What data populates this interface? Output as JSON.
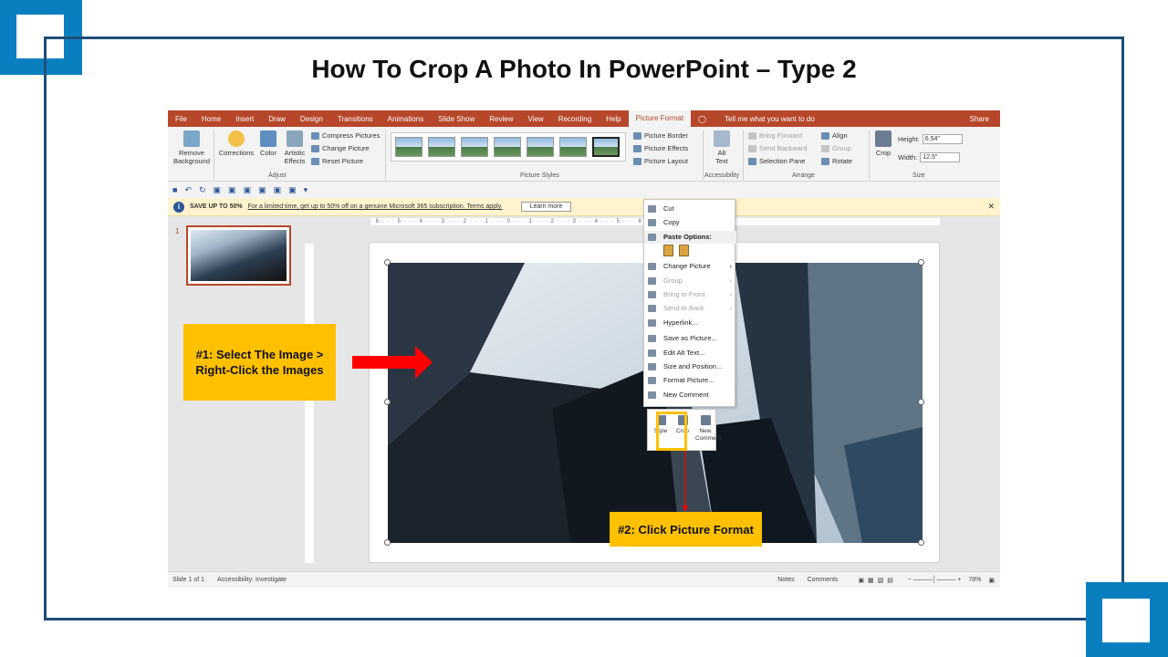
{
  "title": "How To Crop A Photo In PowerPoint – Type 2",
  "menubar": {
    "tabs": [
      "File",
      "Home",
      "Insert",
      "Draw",
      "Design",
      "Transitions",
      "Animations",
      "Slide Show",
      "Review",
      "View",
      "Recording",
      "Help",
      "Picture Format"
    ],
    "tell": "Tell me what you want to do",
    "share": "Share"
  },
  "ribbon": {
    "remove_bg_1": "Remove",
    "remove_bg_2": "Background",
    "corrections": "Corrections",
    "color": "Color",
    "artistic_1": "Artistic",
    "artistic_2": "Effects",
    "compress": "Compress Pictures",
    "change_picture": "Change Picture",
    "reset_picture": "Reset Picture",
    "group_adjust": "Adjust",
    "group_styles": "Picture Styles",
    "picture_border": "Picture Border",
    "picture_effects": "Picture Effects",
    "picture_layout": "Picture Layout",
    "alt_text_1": "Alt",
    "alt_text_2": "Text",
    "group_accessibility": "Accessibility",
    "bring_forward": "Bring Forward",
    "send_backward": "Send Backward",
    "selection_pane": "Selection Pane",
    "align": "Align",
    "group_btn": "Group",
    "rotate": "Rotate",
    "group_arrange": "Arrange",
    "crop": "Crop",
    "height_label": "Height:",
    "height_value": "6.54\"",
    "width_label": "Width:",
    "width_value": "12.5\"",
    "group_size": "Size"
  },
  "banner": {
    "bold": "SAVE UP TO 50%",
    "link": "For a limited time, get up to 50% off on a genuine Microsoft 365 subscription. Terms apply.",
    "button": "Learn more"
  },
  "ruler_text": "· 6 · · · 5 · · · 4 · · · 3 · · · 2 · · · 1 · · · 0 · · · 1 · · · 2 · · · 3 · · · 4 · · · 5 · · · 6 ·",
  "slide_number": "1",
  "context_menu": {
    "items": [
      {
        "label": "Cut",
        "disabled": false,
        "arrow": false
      },
      {
        "label": "Copy",
        "disabled": false,
        "arrow": false
      },
      {
        "label": "Paste Options:",
        "disabled": false,
        "arrow": false,
        "header": true
      },
      {
        "label": "Change Picture",
        "disabled": false,
        "arrow": true
      },
      {
        "label": "Group",
        "disabled": true,
        "arrow": true
      },
      {
        "label": "Bring to Front",
        "disabled": true,
        "arrow": true
      },
      {
        "label": "Send to Back",
        "disabled": true,
        "arrow": true
      },
      {
        "label": "Hyperlink...",
        "disabled": false,
        "arrow": false
      },
      {
        "label": "Save as Picture...",
        "disabled": false,
        "arrow": false
      },
      {
        "label": "Edit Alt Text...",
        "disabled": false,
        "arrow": false
      },
      {
        "label": "Size and Position...",
        "disabled": false,
        "arrow": false
      },
      {
        "label": "Format Picture...",
        "disabled": false,
        "arrow": false
      },
      {
        "label": "New Comment",
        "disabled": false,
        "arrow": false
      }
    ]
  },
  "mini_toolbar": {
    "style": "Style",
    "crop": "Crop",
    "new_comment_1": "New",
    "new_comment_2": "Comment"
  },
  "status": {
    "slide_of": "Slide 1 of 1",
    "accessibility": "Accessibility: Investigate",
    "notes": "Notes",
    "comments": "Comments",
    "zoom": "78%"
  },
  "callouts": {
    "step1": "#1: Select The Image > Right-Click the Images",
    "step2": "#2: Click Picture Format"
  },
  "colors": {
    "accent": "#b7472a",
    "callout": "#ffc000",
    "frame": "#1f4e79",
    "corner": "#0a7fc0",
    "arrow": "#ff0000"
  }
}
